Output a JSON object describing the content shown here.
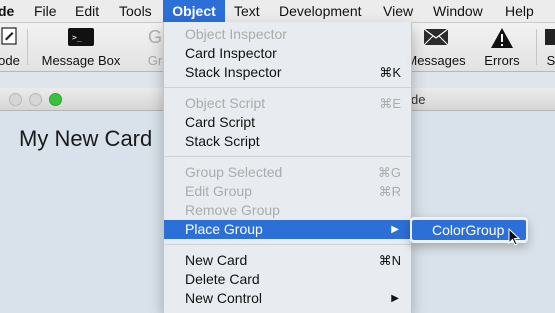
{
  "menubar": {
    "items": [
      {
        "label": "de"
      },
      {
        "label": "File"
      },
      {
        "label": "Edit"
      },
      {
        "label": "Tools"
      },
      {
        "label": "Object"
      },
      {
        "label": "Text"
      },
      {
        "label": "Development"
      },
      {
        "label": "View"
      },
      {
        "label": "Window"
      },
      {
        "label": "Help"
      }
    ]
  },
  "toolbar": {
    "items": [
      {
        "label": "ode",
        "icon": "edit-icon"
      },
      {
        "label": "Message Box",
        "icon": "terminal-icon"
      },
      {
        "label": "Gr",
        "icon": "group-icon"
      },
      {
        "label": "Messages",
        "icon": "envelope-icon"
      },
      {
        "label": "Errors",
        "icon": "warning-icon"
      },
      {
        "label": "S",
        "icon": "sample-icon"
      }
    ]
  },
  "window": {
    "title_fragment": "de",
    "card_text": "My New Card"
  },
  "object_menu": {
    "items": [
      {
        "label": "Object Inspector",
        "shortcut": "",
        "enabled": false
      },
      {
        "label": "Card Inspector",
        "shortcut": "",
        "enabled": true
      },
      {
        "label": "Stack Inspector",
        "shortcut": "⌘K",
        "enabled": true
      },
      {
        "label": "Object Script",
        "shortcut": "⌘E",
        "enabled": false
      },
      {
        "label": "Card Script",
        "shortcut": "",
        "enabled": true
      },
      {
        "label": "Stack Script",
        "shortcut": "",
        "enabled": true
      },
      {
        "label": "Group Selected",
        "shortcut": "⌘G",
        "enabled": false
      },
      {
        "label": "Edit Group",
        "shortcut": "⌘R",
        "enabled": false
      },
      {
        "label": "Remove Group",
        "shortcut": "",
        "enabled": false
      },
      {
        "label": "Place Group",
        "shortcut": "",
        "enabled": true,
        "submenu_arrow": "▶"
      },
      {
        "label": "New Card",
        "shortcut": "⌘N",
        "enabled": true
      },
      {
        "label": "Delete Card",
        "shortcut": "",
        "enabled": true
      },
      {
        "label": "New Control",
        "shortcut": "",
        "enabled": true,
        "submenu_arrow": "▶"
      }
    ]
  },
  "submenu": {
    "items": [
      {
        "label": "ColorGroup"
      }
    ]
  },
  "colors": {
    "highlight": "#2c6fd7",
    "menubar_bg": "#ececec",
    "disabled_text": "#ababab"
  }
}
